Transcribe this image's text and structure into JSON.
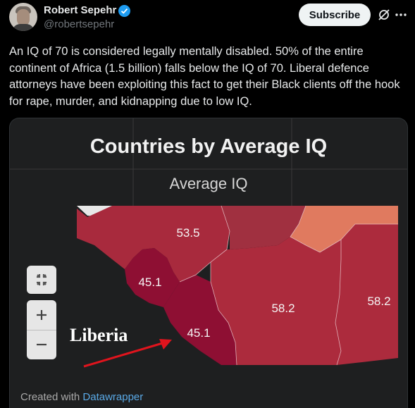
{
  "post": {
    "author_name": "Robert Sepehr",
    "author_handle": "@robertsepehr",
    "subscribe_label": "Subscribe",
    "text": "An IQ of 70 is considered legally mentally disabled. 50% of the entire continent of Africa (1.5 billion) falls below the IQ of 70. Liberal defence attorneys have been exploiting this fact to get their Black clients off the hook for rape, murder, and kidnapping due to low IQ."
  },
  "map": {
    "title": "Countries by Average IQ",
    "legend_title": "Average IQ",
    "labels": {
      "guinea": "53.5",
      "sierra_leone": "45.1",
      "liberia": "45.1",
      "cote_divoire": "58.2",
      "ghana": "58.2"
    },
    "annotation": "Liberia",
    "credit_prefix": "Created with",
    "credit_brand": "Datawrapper",
    "colors": {
      "guinea": "#a82a3d",
      "mali_east": "#a03040",
      "burkina": "#e07a5f",
      "sierra_leone": "#8e0f33",
      "liberia": "#8e0f33",
      "cote_divoire": "#ac2b3d",
      "ghana": "#ac2b3d",
      "arrow": "#e0141d"
    }
  }
}
